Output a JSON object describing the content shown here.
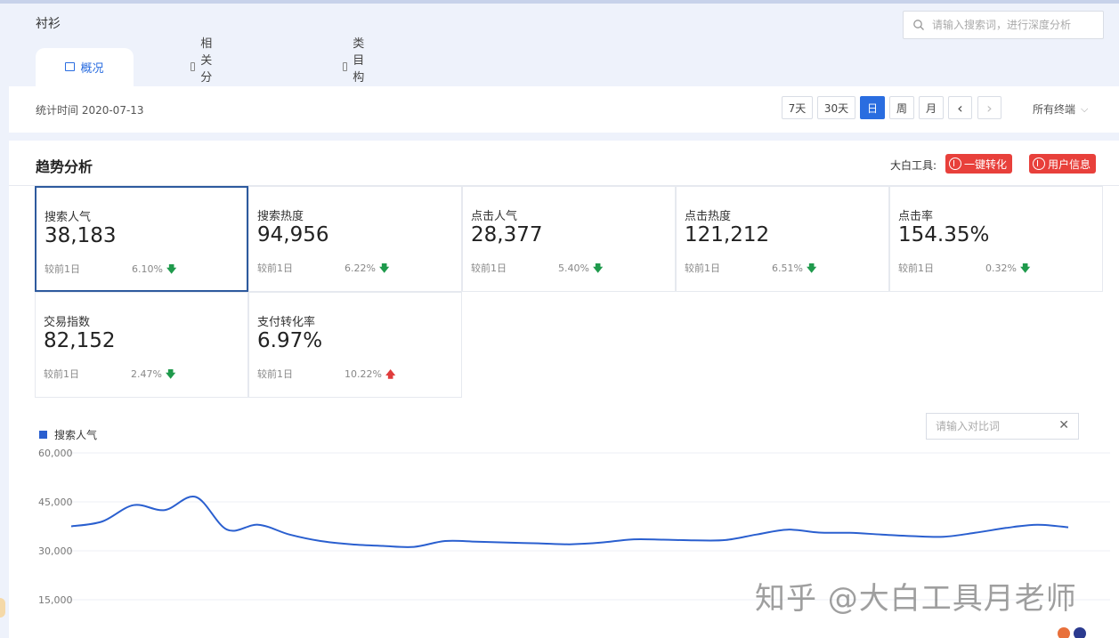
{
  "header": {
    "title": "衬衫",
    "search_placeholder": "请输入搜索词，进行深度分析",
    "tabs": [
      {
        "label": "概况",
        "active": true
      },
      {
        "label": "相关分析",
        "active": false
      },
      {
        "label": "类目构成",
        "active": false
      }
    ]
  },
  "toolbar": {
    "stat_time": "统计时间 2020-07-13",
    "ranges": [
      {
        "label": "7天",
        "active": false
      },
      {
        "label": "30天",
        "active": false
      },
      {
        "label": "日",
        "active": true
      },
      {
        "label": "周",
        "active": false
      },
      {
        "label": "月",
        "active": false
      }
    ],
    "prev": "‹",
    "next": "›",
    "terminal": "所有终端",
    "terminal_chevron": "⌵"
  },
  "trend": {
    "title": "趋势分析",
    "tool_label": "大白工具:",
    "buttons": [
      "一键转化",
      "用户信息"
    ]
  },
  "metrics": [
    {
      "name": "搜索人气",
      "value": "38,183",
      "compare_label": "较前1日",
      "change": "6.10%",
      "direction": "down",
      "selected": true
    },
    {
      "name": "搜索热度",
      "value": "94,956",
      "compare_label": "较前1日",
      "change": "6.22%",
      "direction": "down",
      "selected": false
    },
    {
      "name": "点击人气",
      "value": "28,377",
      "compare_label": "较前1日",
      "change": "5.40%",
      "direction": "down",
      "selected": false
    },
    {
      "name": "点击热度",
      "value": "121,212",
      "compare_label": "较前1日",
      "change": "6.51%",
      "direction": "down",
      "selected": false
    },
    {
      "name": "点击率",
      "value": "154.35%",
      "compare_label": "较前1日",
      "change": "0.32%",
      "direction": "down",
      "selected": false
    },
    {
      "name": "交易指数",
      "value": "82,152",
      "compare_label": "较前1日",
      "change": "2.47%",
      "direction": "down",
      "selected": false
    },
    {
      "name": "支付转化率",
      "value": "6.97%",
      "compare_label": "较前1日",
      "change": "10.22%",
      "direction": "up",
      "selected": false
    }
  ],
  "compare_placeholder": "请输入对比词",
  "compare_clear": "✕",
  "arrows": {
    "down": "🡇",
    "up": "🡅"
  },
  "colors": {
    "accent": "#2a6de0",
    "series": "#2a5fcf",
    "red_button": "#e8403b",
    "down": "#1f9a4c",
    "up": "#e03c3c"
  },
  "chart_data": {
    "type": "line",
    "series": [
      {
        "name": "搜索人气",
        "values": [
          37500,
          39000,
          44000,
          42500,
          46500,
          36500,
          38000,
          35000,
          33000,
          32000,
          31500,
          31200,
          33000,
          32800,
          32500,
          32300,
          32000,
          32500,
          33500,
          33400,
          33200,
          33300,
          35000,
          36500,
          35600,
          35500,
          35000,
          34500,
          34300,
          35500,
          37000,
          38000,
          37200
        ]
      }
    ],
    "y_ticks": [
      "60,000",
      "45,000",
      "30,000",
      "15,000"
    ],
    "ylim": [
      0,
      60000
    ],
    "grid": true,
    "legend": "top-left"
  },
  "watermark": "知乎 @大白工具月老师"
}
